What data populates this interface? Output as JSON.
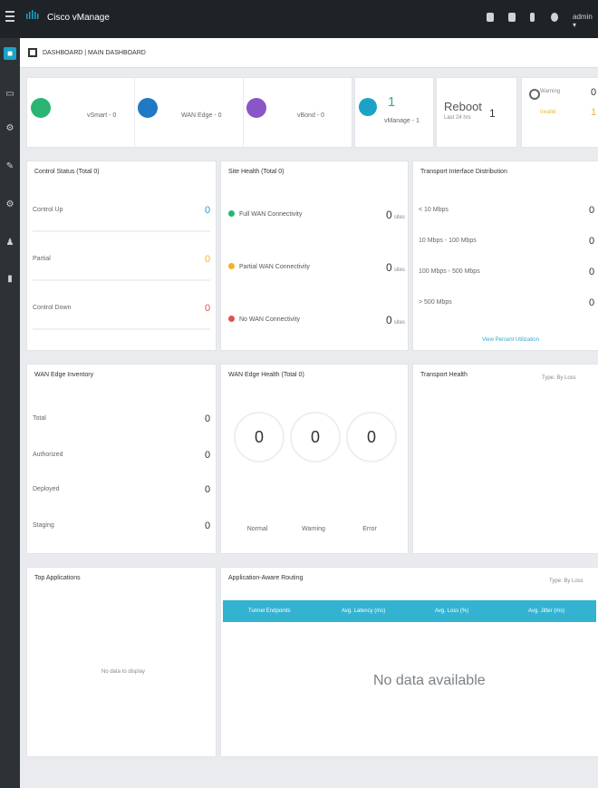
{
  "app": {
    "name": "Cisco vManage",
    "user": "admin ▾"
  },
  "breadcrumb": "DASHBOARD | MAIN DASHBOARD",
  "summary": {
    "vsmart": "vSmart - 0",
    "wan_edge": "WAN Edge - 0",
    "vbond": "vBond - 0",
    "vmanage": {
      "label": "vManage - 1",
      "count": "1"
    },
    "reboot": {
      "label": "Reboot",
      "sub": "Last 24 hrs",
      "count": "1"
    },
    "warning": {
      "label": "Warning",
      "count": "0"
    },
    "invalid": {
      "label": "Invalid",
      "count": "1"
    }
  },
  "control_status": {
    "title": "Control Status (Total 0)",
    "rows": [
      {
        "label": "Control Up",
        "value": "0",
        "color": "#1aa3c6"
      },
      {
        "label": "Partial",
        "value": "0",
        "color": "#f0b429"
      },
      {
        "label": "Control Down",
        "value": "0",
        "color": "#e05252"
      }
    ]
  },
  "site_health": {
    "title": "Site Health (Total 0)",
    "unit": "sites",
    "rows": [
      {
        "label": "Full WAN Connectivity",
        "value": "0",
        "color": "#2bb573"
      },
      {
        "label": "Partial WAN Connectivity",
        "value": "0",
        "color": "#f0b429"
      },
      {
        "label": "No WAN Connectivity",
        "value": "0",
        "color": "#e05252"
      }
    ]
  },
  "transport_interface": {
    "title": "Transport Interface Distribution",
    "rows": [
      {
        "label": "< 10 Mbps",
        "value": "0"
      },
      {
        "label": "10 Mbps - 100 Mbps",
        "value": "0"
      },
      {
        "label": "100 Mbps - 500 Mbps",
        "value": "0"
      },
      {
        "label": "> 500 Mbps",
        "value": "0"
      }
    ],
    "link": "View Percent Utilization"
  },
  "wan_inventory": {
    "title": "WAN Edge Inventory",
    "rows": [
      {
        "label": "Total",
        "value": "0"
      },
      {
        "label": "Authorized",
        "value": "0"
      },
      {
        "label": "Deployed",
        "value": "0"
      },
      {
        "label": "Staging",
        "value": "0"
      }
    ]
  },
  "wan_health": {
    "title": "WAN Edge Health (Total 0)",
    "rings": [
      {
        "label": "Normal",
        "value": "0"
      },
      {
        "label": "Warning",
        "value": "0"
      },
      {
        "label": "Error",
        "value": "0"
      }
    ]
  },
  "transport_health": {
    "title": "Transport Health",
    "type_label": "Type: By Loss"
  },
  "top_apps": {
    "title": "Top Applications",
    "empty": "No data to display"
  },
  "aar": {
    "title": "Application-Aware Routing",
    "type_label": "Type: By Loss",
    "columns": [
      "Tunnel Endpoints",
      "Avg. Latency (ms)",
      "Avg. Loss (%)",
      "Avg. Jitter (ms)"
    ],
    "empty": "No data available"
  },
  "colors": {
    "accent": "#1aa3c6",
    "topbar": "#1f2327",
    "sidebar": "#2d3237"
  }
}
